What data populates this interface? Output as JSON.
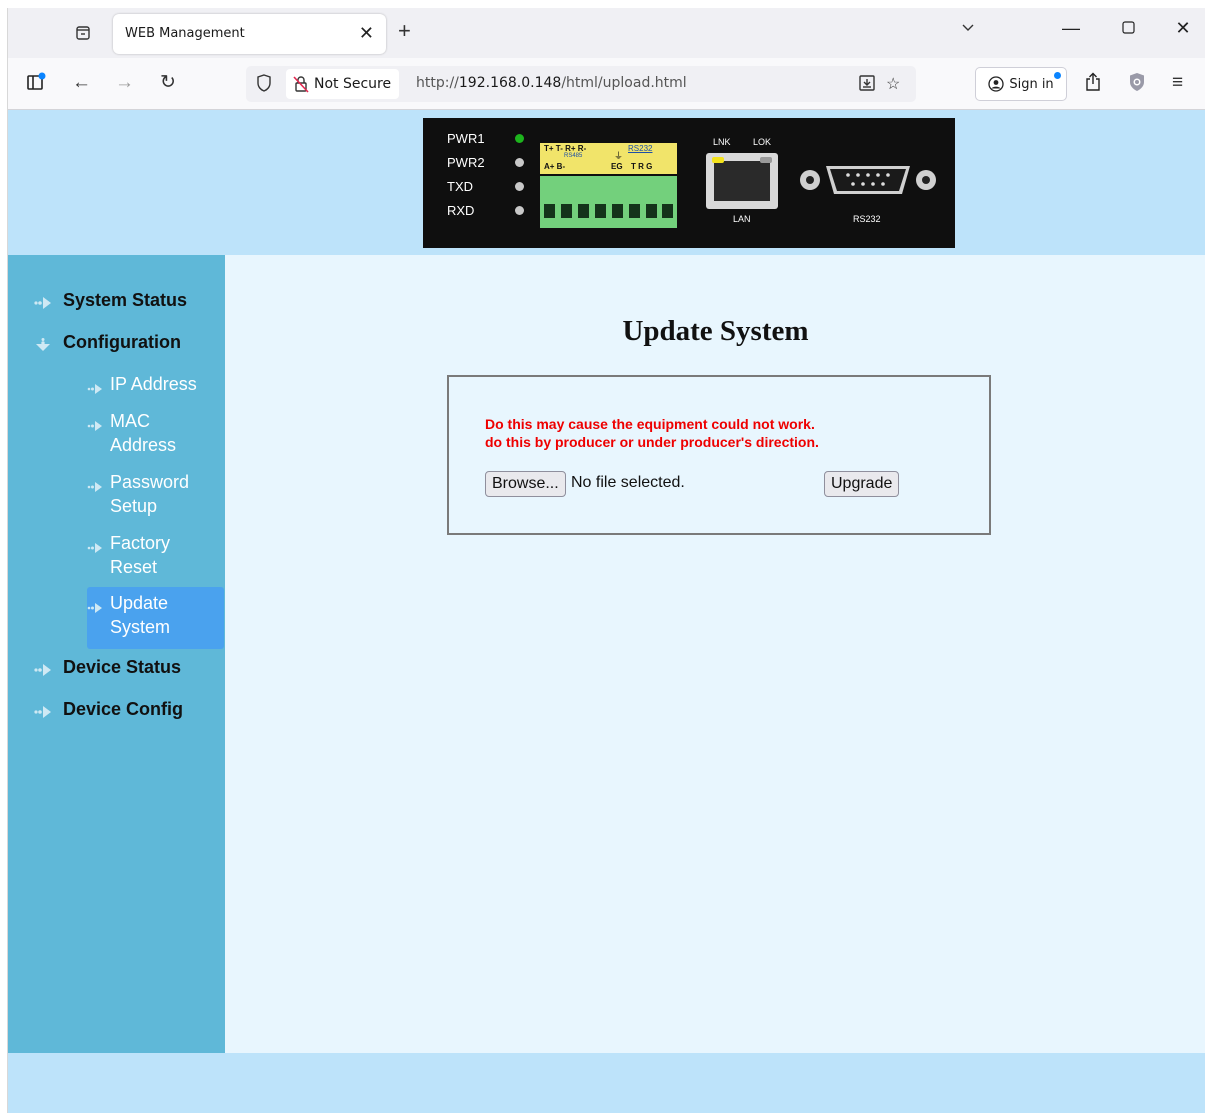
{
  "browser": {
    "tab_title": "WEB Management",
    "not_secure_label": "Not Secure",
    "url_prefix": "http://",
    "url_host": "192.168.0.148",
    "url_path": "/html/upload.html",
    "sign_in_label": "Sign in"
  },
  "device_panel": {
    "leds": [
      {
        "label": "PWR1",
        "color": "#1db41d"
      },
      {
        "label": "PWR2",
        "color": "#c8c8c8"
      },
      {
        "label": "TXD",
        "color": "#c8c8c8"
      },
      {
        "label": "RXD",
        "color": "#c8c8c8"
      }
    ],
    "terminal_labels": {
      "row1": "T+ T-  R+ R-",
      "rs232": "RS232",
      "row2": "A+ B-",
      "rs485": "RS485",
      "eg": "EG",
      "trg": "T  R  G"
    },
    "lnk_label": "LNK",
    "lok_label": "LOK",
    "lan_label": "LAN",
    "rs232_label": "RS232"
  },
  "sidebar": {
    "system_status": "System Status",
    "configuration": "Configuration",
    "sub_items": [
      {
        "label": "IP Address"
      },
      {
        "label": "MAC Address"
      },
      {
        "label": "Password Setup"
      },
      {
        "label": "Factory Reset"
      },
      {
        "label": "Update System"
      }
    ],
    "device_status": "Device Status",
    "device_config": "Device Config"
  },
  "main": {
    "title": "Update System",
    "warning_line1": "Do this may cause the equipment could not work.",
    "warning_line2": "do this by producer or under producer's direction.",
    "browse_label": "Browse...",
    "no_file_label": "No file selected.",
    "upgrade_label": "Upgrade"
  },
  "colors": {
    "banner": "#bde3fa",
    "sidebar": "#5fb8d8",
    "active_item": "#4aa2ee",
    "content": "#e8f6fe",
    "warning": "#ee0000"
  }
}
